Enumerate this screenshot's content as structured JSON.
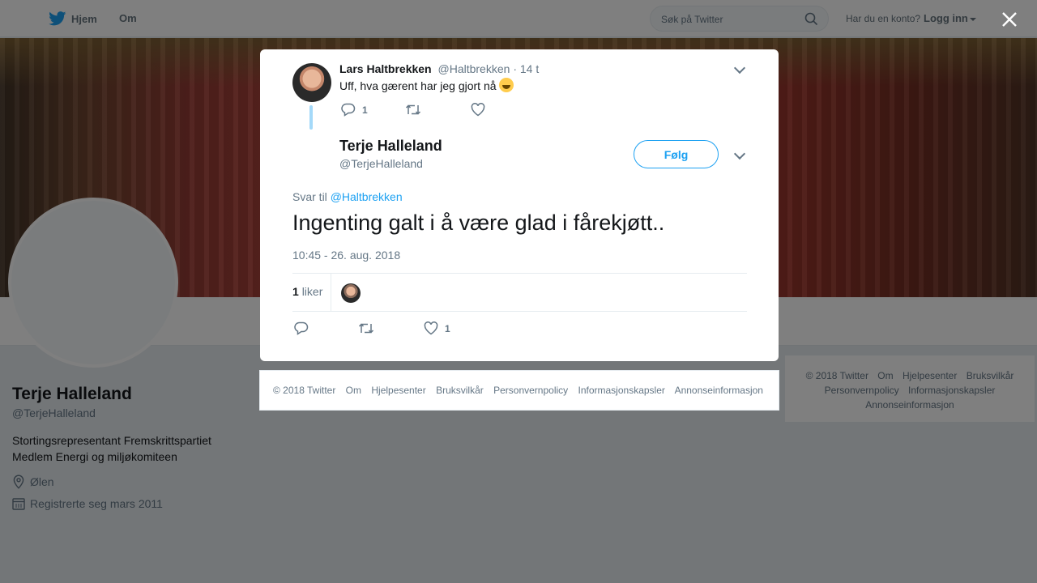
{
  "nav": {
    "home_label": "Hjem",
    "about_label": "Om"
  },
  "search": {
    "placeholder": "Søk på Twitter"
  },
  "account": {
    "question": "Har du en konto?",
    "login_label": "Logg inn"
  },
  "profile": {
    "name": "Terje Halleland",
    "handle": "@TerjeHalleland",
    "bio_line1": "Stortingsrepresentant Fremskrittspartiet",
    "bio_line2": "Medlem Energi og miljøkomiteen",
    "location": "Ølen",
    "joined": "Registrerte seg mars 2011"
  },
  "parent_tweet": {
    "name": "Lars Haltbrekken",
    "handle": "@Haltbrekken",
    "time": "· 14 t",
    "text": "Uff, hva gærent har jeg gjort nå",
    "reply_count": "1"
  },
  "tweet": {
    "name": "Terje Halleland",
    "handle": "@TerjeHalleland",
    "follow_label": "Følg",
    "reply_prefix": "Svar til",
    "reply_handle": "@Haltbrekken",
    "text": "Ingenting galt i å være glad i fårekjøtt..",
    "timestamp": "10:45 - 26. aug. 2018",
    "likes_count": "1",
    "likes_label": "liker",
    "like_action_count": "1"
  },
  "footer": {
    "copyright": "© 2018 Twitter",
    "about": "Om",
    "help": "Hjelpesenter",
    "terms": "Bruksvilkår",
    "privacy": "Personvernpolicy",
    "cookies": "Informasjonskapsler",
    "ads": "Annonseinformasjon"
  },
  "colors": {
    "accent": "#1da1f2",
    "muted": "#657786",
    "thread": "#a4d9f9"
  }
}
